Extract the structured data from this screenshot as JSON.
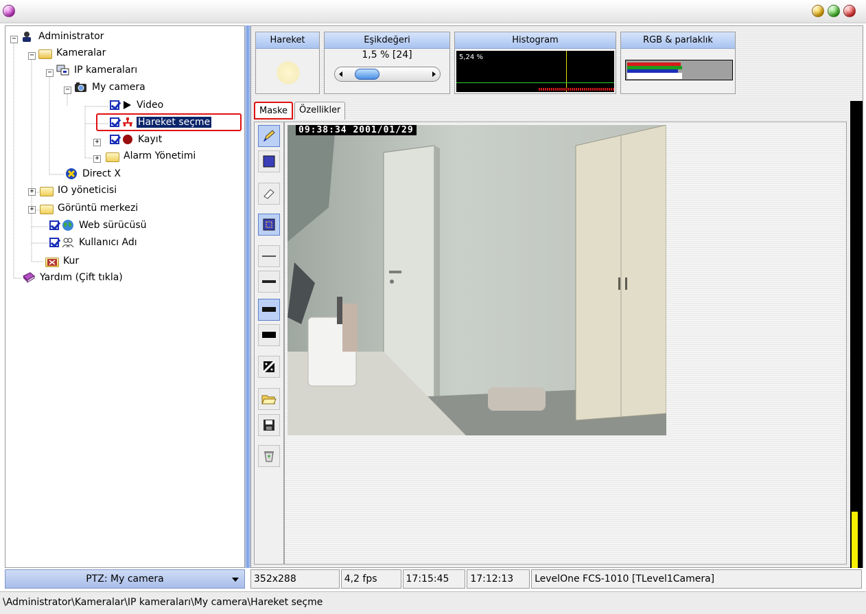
{
  "tree": {
    "items": [
      {
        "label": "Administrator",
        "icon": "administrator-icon"
      },
      {
        "label": "Kameralar",
        "icon": "folder-open-icon"
      },
      {
        "label": "IP kameraları",
        "icon": "network-camera-icon"
      },
      {
        "label": "My camera",
        "icon": "camera-icon"
      },
      {
        "label": "Video",
        "icon": "play-icon"
      },
      {
        "label": "Hareket seçme",
        "icon": "motion-detect-icon"
      },
      {
        "label": "Kayıt",
        "icon": "record-icon"
      },
      {
        "label": "Alarm Yönetimi",
        "icon": "folder-icon"
      },
      {
        "label": "Direct X",
        "icon": "directx-icon"
      },
      {
        "label": "IO yöneticisi",
        "icon": "folder-icon"
      },
      {
        "label": "Görüntü merkezi",
        "icon": "folder-icon"
      },
      {
        "label": "Web sürücüsü",
        "icon": "globe-icon"
      },
      {
        "label": "Kullanıcı Adı",
        "icon": "users-icon"
      },
      {
        "label": "Kur",
        "icon": "setup-folder-icon"
      },
      {
        "label": "Yardım (Çift tıkla)",
        "icon": "help-book-icon"
      }
    ]
  },
  "meters": {
    "motion": {
      "label": "Hareket"
    },
    "threshold": {
      "label": "Eşikdeğeri",
      "value": "1,5 % [24]",
      "slider_fraction": 0.15
    },
    "histogram": {
      "label": "Histogram",
      "value": "5,24 %"
    },
    "rgb": {
      "label": "RGB & parlaklık"
    }
  },
  "tabs": [
    {
      "label": "Maske"
    },
    {
      "label": "Özellikler"
    }
  ],
  "tools": [
    "pen-icon",
    "fill-rect-icon",
    "eraser-icon",
    "select-rect-icon",
    "line-thin-icon",
    "line-medium-icon",
    "line-thick-icon",
    "line-extra-thick-icon",
    "invert-mask-icon",
    "open-folder-icon",
    "save-disk-icon",
    "recycle-bin-icon"
  ],
  "video": {
    "timestamp": "09:38:34 2001/01/29"
  },
  "vu_level": 0.12,
  "ptz": {
    "label": "PTZ: My camera"
  },
  "status": {
    "resolution": "352x288",
    "fps": "4,2 fps",
    "time1": "17:15:45",
    "time2": "17:12:13",
    "camera_model": "LevelOne FCS-1010 [TLevel1Camera]"
  },
  "path": "\\Administrator\\Kameralar\\IP kameraları\\My camera\\Hareket seçme",
  "colors": {
    "selection": "#0a246a",
    "splitter": "#7b9fe0",
    "highlight": "#e01010",
    "vu": "#f6f000"
  }
}
